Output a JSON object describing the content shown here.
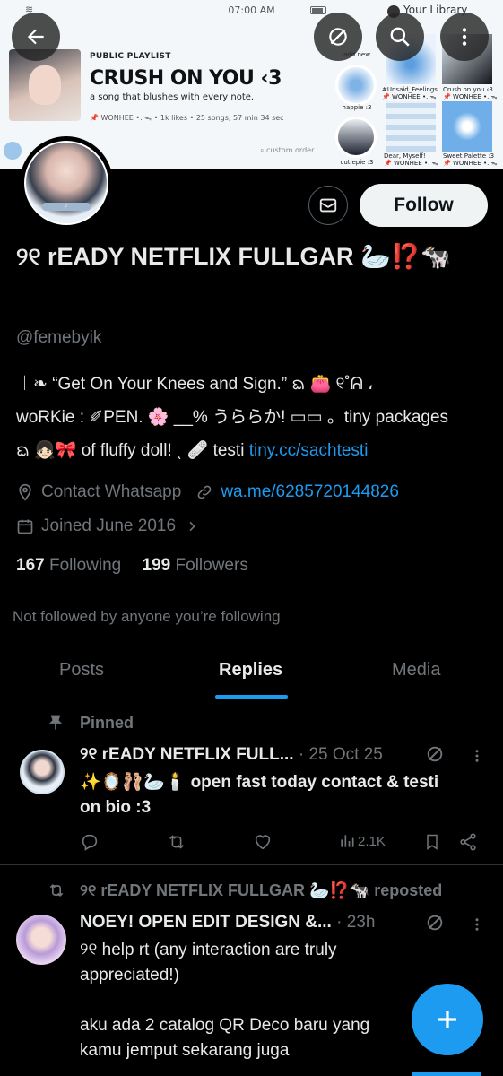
{
  "status_bar": {
    "time": "07:00 AM",
    "library_title": "Your Library"
  },
  "banner": {
    "playlist_label": "PUBLIC PLAYLIST",
    "playlist_title": "CRUSH ON YOU ‹3",
    "playlist_desc": "a song that blushes with every note.",
    "playlist_meta": "📌 WONHEE •. ᯓ • 1k likes • 25 songs, 57 min 34 sec",
    "custom_order": "custom order",
    "library_items": [
      {
        "label": "add new"
      },
      {
        "label": "happie :3"
      },
      {
        "label": "cutiepie :3"
      },
      {
        "label": "#Unsaid_Feelings",
        "sub": "📌 WONHEE •. ᯓ"
      },
      {
        "label": "Crush on you ‹3",
        "sub": "📌 WONHEE •. ᯓ"
      },
      {
        "label": "Dear, Myself!",
        "sub": "📌 WONHEE •. ᯓ"
      },
      {
        "label": "Sweet Palette :3",
        "sub": "📌 WONHEE •. ᯓ"
      }
    ]
  },
  "profile": {
    "follow_label": "Follow",
    "display_name": "୨୧ rEADY NETFLIX FULLGAR 🦢⁉️🐄",
    "handle": "@femebyik",
    "bio_line1": "︱❧ “Get On Your Knees and Sign.” ᨳ 👛 ୧˚ᕱ ،",
    "bio_line2": "woRKie : ✐PEN. 🌸 __% うららか! ▭▭ 。tiny packages",
    "bio_line3_prefix": "ᨳ 👧🏻🎀 of fluffy doll! ˎ 🩹 testi ",
    "bio_link": "tiny.cc/sachtesti",
    "location": "Contact Whatsapp",
    "website": "wa.me/6285720144826",
    "joined": "Joined June 2016",
    "following_count": "167",
    "following_label": "Following",
    "followers_count": "199",
    "followers_label": "Followers",
    "not_followed": "Not followed by anyone you’re following"
  },
  "tabs": [
    "Posts",
    "Replies",
    "Media"
  ],
  "tweets": [
    {
      "context": "Pinned",
      "name": "୨୧ rEADY NETFLIX FULL...",
      "date": "· 25 Oct 25",
      "text_line1": "✨🪞🩰🦢🕯️ open fast today contact & testi",
      "text_line2": "on bio :3",
      "views": "2.1K"
    },
    {
      "context": "୨୧ rEADY NETFLIX FULLGAR 🦢⁉️🐄 reposted",
      "name": "NOEY! OPEN EDIT DESIGN &...",
      "date": "· 23h",
      "text_line1": "୨୧ help rt (any interaction are truly",
      "text_line2": "appreciated!)",
      "text_line3": "aku ada 2 catalog QR Deco baru yang",
      "text_line4": "kamu jemput sekarang juga"
    }
  ],
  "colors": {
    "accent": "#1d9bf0",
    "muted": "#71767b",
    "text": "#e7e9ea",
    "background": "#000000"
  }
}
